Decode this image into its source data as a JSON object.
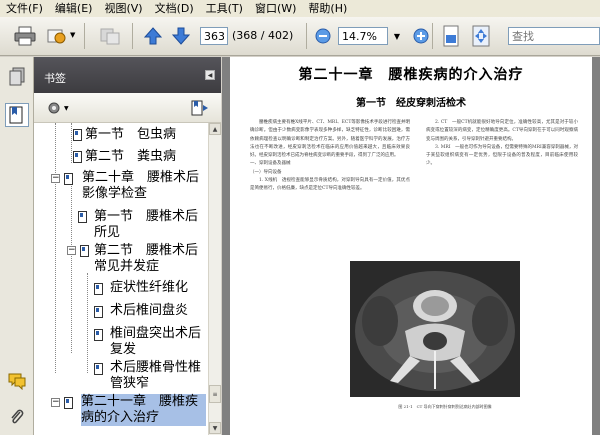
{
  "menubar": {
    "items": [
      "文件(F)",
      "编辑(E)",
      "视图(V)",
      "文档(D)",
      "工具(T)",
      "窗口(W)",
      "帮助(H)"
    ]
  },
  "toolbar": {
    "page_current": "363",
    "page_total": "(368 / 402)",
    "zoom_value": "14.7%",
    "search_placeholder": "查找"
  },
  "bookmarks": {
    "header_title": "书签",
    "items": [
      {
        "label": "第一节　包虫病"
      },
      {
        "label": "第二节　粪虫病"
      },
      {
        "label": "第二十章　腰椎术后影像学检查"
      },
      {
        "label": "第一节　腰椎术后所见"
      },
      {
        "label": "第二节　腰椎术后常见并发症"
      },
      {
        "label": "症状性纤维化"
      },
      {
        "label": "术后椎间盘炎"
      },
      {
        "label": "椎间盘突出术后复发"
      },
      {
        "label": "术后腰椎骨性椎管狭窄"
      },
      {
        "label": "第二十一章　腰椎疾病的介入治疗"
      }
    ]
  },
  "document": {
    "chapter_title": "第二十一章　腰椎疾病的介入治疗",
    "section_title": "第一节　经皮穿刺活检术",
    "left_paragraph_1": "腰椎疾病主要有椎X线平片、CT、MRI、ECT等影像技术手段进行检查并明确诊断。但由于少数病变影像学表现多种多样，缺乏特征性，诊断比较困难，需依赖病理检查以明确诊断和制定治疗方案。另外，随着医学科学的发展，治疗方法也在不断改进，经皮穿刺活检术在临床的应用价值越来越大，且临床效果良好。经皮穿刺活检术已成为脊柱病变诊断的重要手段，得到了广泛的应用。",
    "left_heading_1": "一、穿刺设备及器械",
    "left_heading_2": "（一）导向设备",
    "left_paragraph_2": "1. X线机　透视检查能够显示骨质结构，对穿刺导向具有一定价值，其优点是简便易行，价格低廉，缺点是定位CT导向准确性较差。",
    "right_paragraph_1": "2. CT　一般CT机就能很好地导向定位，准确性较高，尤其是对于较小病变或位置较深的病变，定位精确度更高。CT导向穿刺在于可以同时观察病变与周围的关系，引导穿刺针避开重要结构。",
    "right_paragraph_2": "3. MRI　一般也可作为导向设备，但需要特殊的MRI兼容穿刺器械，对于某些软组织病变有一定优势，但限于设备的普及程度，目前临床使用较少。",
    "figure_caption": "图 21-1　CT 导向下穿刺针穿刺到达病灶内部时图像"
  }
}
